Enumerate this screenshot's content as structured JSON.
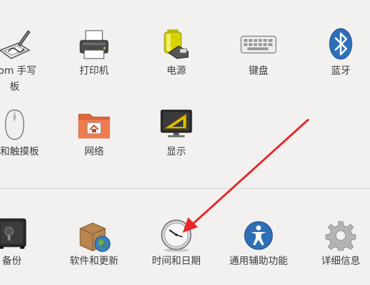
{
  "hardware": {
    "wacom_label": "com 手写",
    "wacom_label2": "板",
    "printer_label": "打印机",
    "power_label": "电源",
    "keyboard_label": "键盘",
    "bluetooth_label": "蓝牙",
    "mouse_label": "标和触摸板",
    "network_label": "网络",
    "display_label": "显示"
  },
  "system": {
    "backup_label": "备份",
    "software_label": "软件和更新",
    "datetime_label": "时间和日期",
    "accessibility_label": "通用辅助功能",
    "details_label": "详细信息"
  },
  "annotation": {
    "arrow_color": "#e8262b"
  }
}
